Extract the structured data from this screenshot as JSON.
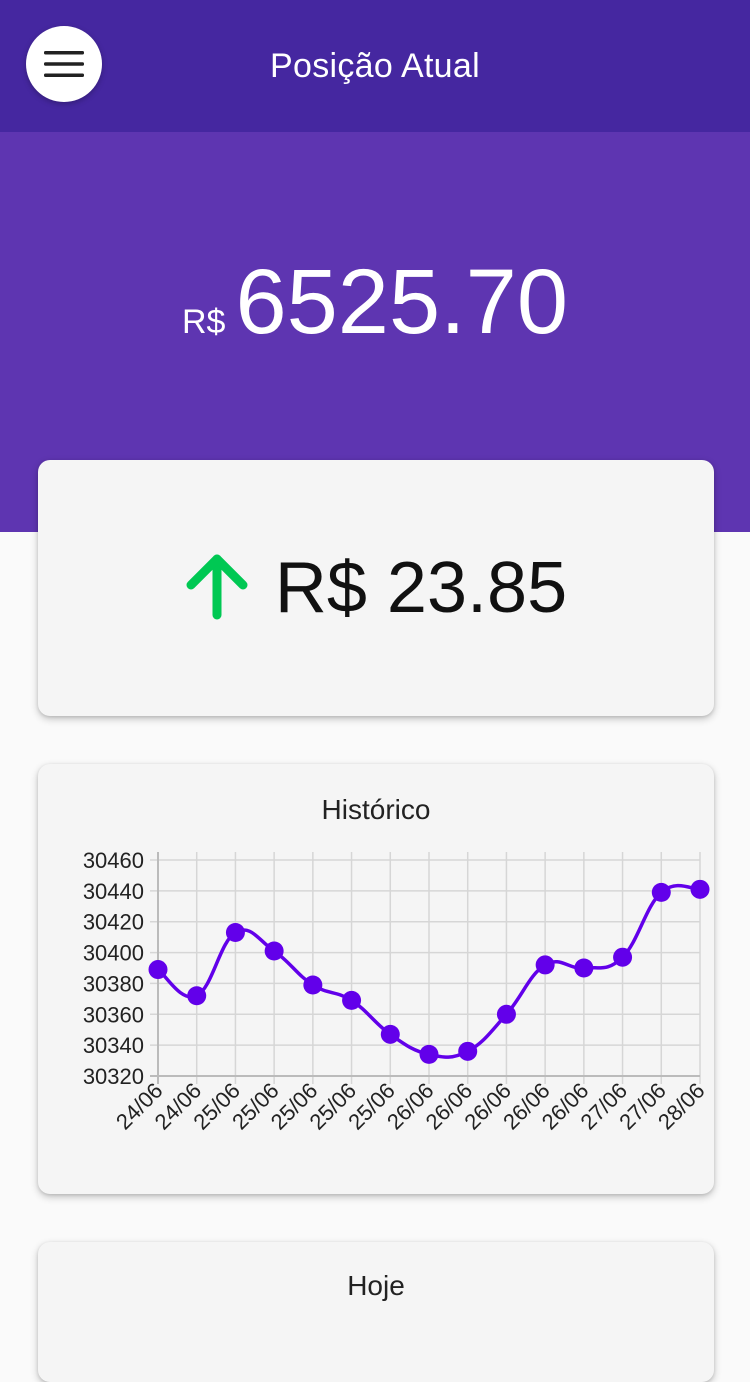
{
  "appbar": {
    "title": "Posição Atual",
    "menu_icon": "hamburger-menu-icon"
  },
  "balance": {
    "currency": "R$",
    "amount": "6525.70"
  },
  "change": {
    "direction_icon": "arrow-up-icon",
    "text": "R$ 23.85",
    "color": "#00c853"
  },
  "history": {
    "title": "Histórico"
  },
  "today": {
    "title": "Hoje"
  },
  "colors": {
    "appbar": "#4527a0",
    "hero": "#5e35b1",
    "series": "#6200ea"
  },
  "chart_data": {
    "type": "line",
    "title": "Histórico",
    "categories": [
      "24/06",
      "24/06",
      "25/06",
      "25/06",
      "25/06",
      "25/06",
      "25/06",
      "26/06",
      "26/06",
      "26/06",
      "26/06",
      "26/06",
      "27/06",
      "27/06",
      "28/06"
    ],
    "values": [
      30389,
      30372,
      30413,
      30401,
      30379,
      30369,
      30347,
      30334,
      30336,
      30360,
      30392,
      30390,
      30397,
      30439,
      30441
    ],
    "y_ticks": [
      30320,
      30340,
      30360,
      30380,
      30400,
      30420,
      30440,
      30460
    ],
    "ylim": [
      30320,
      30460
    ],
    "grid": true,
    "legend": "none"
  }
}
